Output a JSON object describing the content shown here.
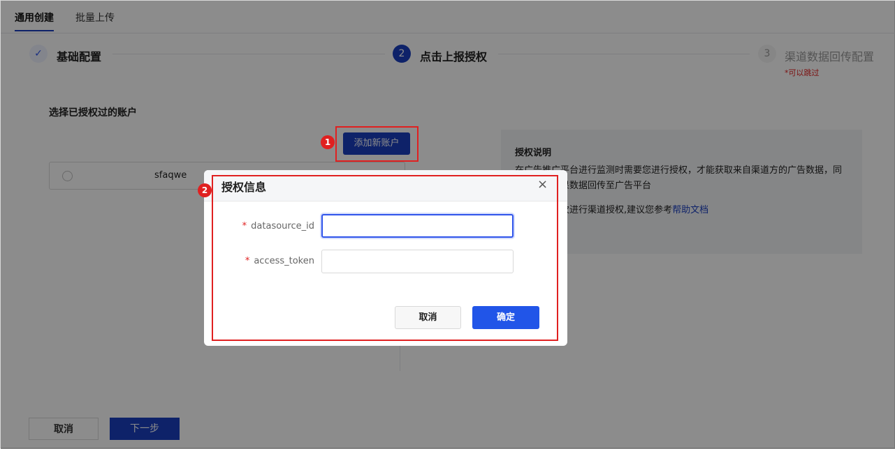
{
  "tabs": [
    {
      "label": "通用创建"
    },
    {
      "label": "批量上传"
    }
  ],
  "steps": [
    {
      "number": "✓",
      "title": "基础配置"
    },
    {
      "number": "2",
      "title": "点击上报授权"
    },
    {
      "number": "3",
      "title": "渠道数据回传配置",
      "note": "*可以跳过"
    }
  ],
  "section": {
    "title": "选择已授权过的账户"
  },
  "add_account_button": "添加新账户",
  "accounts": [
    {
      "name": "sfaqwe"
    }
  ],
  "auth_info": {
    "title": "授权说明",
    "text1": "在广告推广平台进行监测时需要您进行授权，才能获取来自渠道方的广告数据，同时将转化效果数据回传至广告平台",
    "text2_prefix": "如您是第一次进行渠道授权,建议您参考",
    "link": "帮助文档"
  },
  "footer": {
    "cancel": "取消",
    "next": "下一步"
  },
  "modal": {
    "title": "授权信息",
    "close": "×",
    "fields": [
      {
        "label": "datasource_id",
        "required": "*"
      },
      {
        "label": "access_token",
        "required": "*"
      }
    ],
    "cancel": "取消",
    "ok": "确定"
  },
  "annotations": {
    "badge1": "1",
    "badge2": "2"
  },
  "colors": {
    "primary": "#1b3fbf",
    "accent": "#2155e8",
    "annotation_red": "#e02020"
  }
}
